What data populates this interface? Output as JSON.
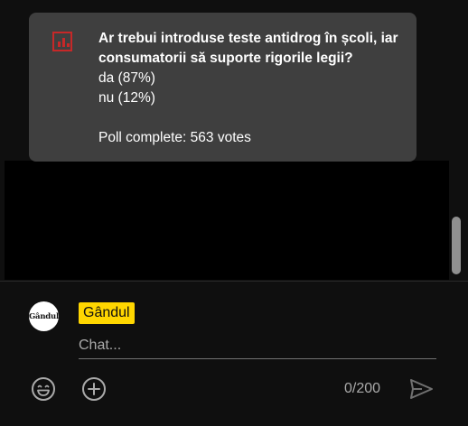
{
  "poll": {
    "question": "Ar trebui introduse teste antidrog în școli, iar consumatorii să suporte rigorile legii?",
    "options": [
      {
        "label": "da (87%)"
      },
      {
        "label": "nu (12%)"
      }
    ],
    "status": "Poll complete: 563 votes",
    "icon": "poll-chart-icon",
    "accent_color": "#c62828"
  },
  "composer": {
    "avatar_text": "Gândul",
    "author_name": "Gândul",
    "author_badge_color": "#ffd600",
    "input_placeholder": "Chat...",
    "input_value": "",
    "char_count": "0/200",
    "icons": {
      "emoji": "emoji-icon",
      "add": "add-icon",
      "send": "send-icon"
    }
  }
}
